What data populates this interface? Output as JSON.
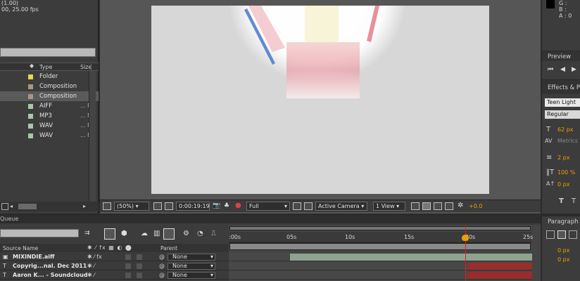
{
  "project": {
    "meta_line1": "(1.00)",
    "meta_line2": "00, 25.00 fps",
    "columns": {
      "type": "Type",
      "size": "Size"
    },
    "items": [
      {
        "type": "Folder",
        "size": "",
        "color": "#e8d84a",
        "selected": false
      },
      {
        "type": "Composition",
        "size": "",
        "color": "#a89880",
        "selected": false
      },
      {
        "type": "Composition",
        "size": "",
        "color": "#a89880",
        "selected": true
      },
      {
        "type": "AIFF",
        "size": "... M",
        "color": "#a8c8a8",
        "selected": false
      },
      {
        "type": "MP3",
        "size": "... M",
        "color": "#a8c8a8",
        "selected": false
      },
      {
        "type": "WAV",
        "size": "... M",
        "color": "#a8c8a8",
        "selected": false
      },
      {
        "type": "WAV",
        "size": "... M",
        "color": "#a8c8a8",
        "selected": false
      }
    ]
  },
  "viewer": {
    "zoom": "(50%)",
    "timecode": "0:00:19:19",
    "resolution": "Full",
    "camera": "Active Camera",
    "view": "1 View",
    "exposure": "+0.0"
  },
  "info": {
    "g": "G :",
    "b": "B :",
    "a": "A : 0"
  },
  "preview": {
    "title": "Preview"
  },
  "effects": {
    "title": "Effects & Pre"
  },
  "character": {
    "font": "Teen Light",
    "style": "Regular",
    "size": "62 px",
    "tracking_label": "Metrics",
    "stroke": "2 px",
    "scale": "100 %",
    "baseline": "0 px",
    "t1": "T",
    "t2": "T"
  },
  "paragraph": {
    "title": "Paragraph",
    "indent1": "0 px",
    "indent2": "0 px"
  },
  "timeline": {
    "tab": "Queue",
    "col_source": "Source Name",
    "col_parent": "Parent",
    "ruler": [
      ":00s",
      "05s",
      "10s",
      "15s",
      "20s",
      "25s"
    ],
    "layers": [
      {
        "name": "MIXINDIE.aiff",
        "parent": "None"
      },
      {
        "name": "Copyrig...nal. Dec 2011",
        "parent": "None"
      },
      {
        "name": "Aaron K... - Soundcloud",
        "parent": "None"
      }
    ]
  },
  "colors": {
    "accent": "#e8a000",
    "playhead": "#e02020"
  }
}
